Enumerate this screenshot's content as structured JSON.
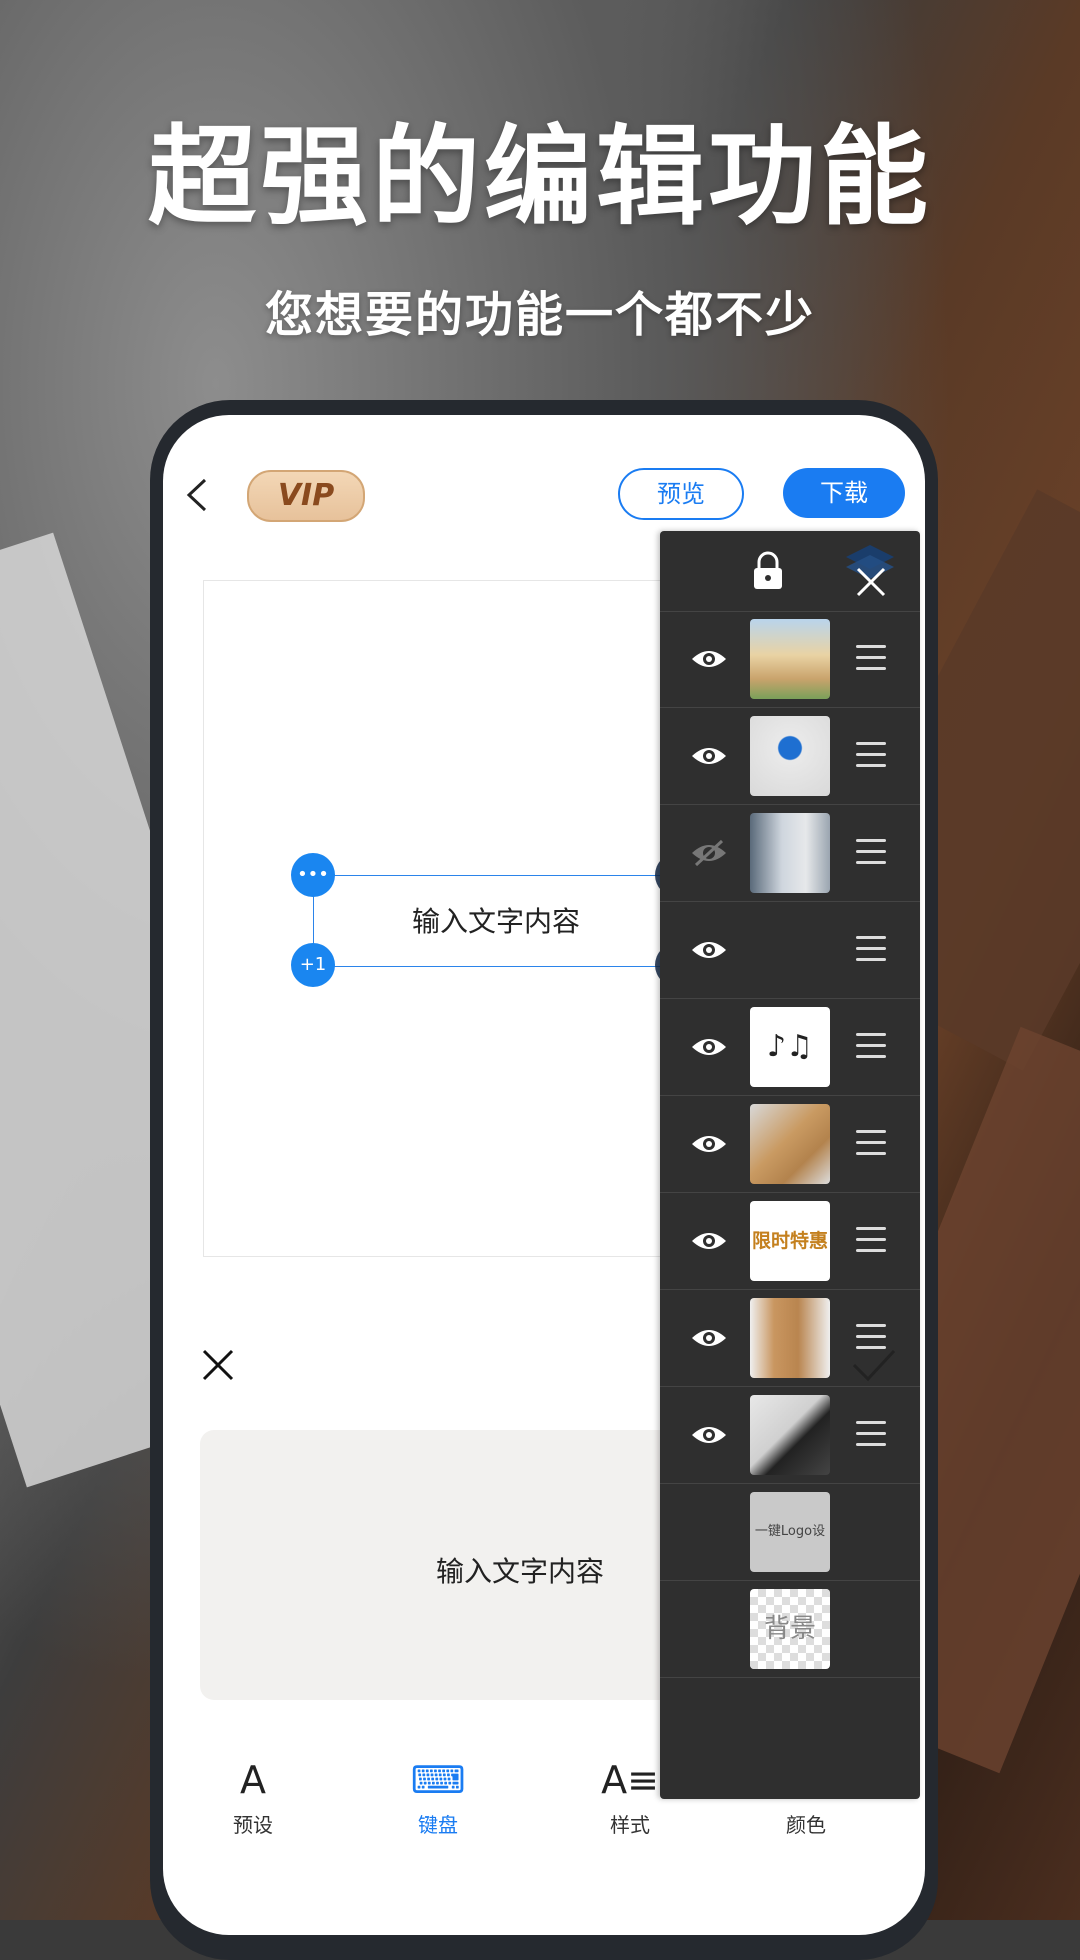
{
  "promo": {
    "headline": "超强的编辑功能",
    "subline": "您想要的功能一个都不少"
  },
  "topbar": {
    "vip_label": "VIP",
    "preview_label": "预览",
    "download_label": "下载"
  },
  "canvas": {
    "text_box_content": "输入文字内容",
    "handle_menu_icon": "more-dots-icon",
    "handle_add_label": "+1"
  },
  "editor": {
    "input_text": "输入文字内容"
  },
  "tabs": [
    {
      "label": "预设",
      "icon": "font-a-icon",
      "active": false
    },
    {
      "label": "键盘",
      "icon": "keyboard-icon",
      "active": true
    },
    {
      "label": "样式",
      "icon": "text-style-icon",
      "active": false
    },
    {
      "label": "颜色",
      "icon": "text-color-icon",
      "active": false
    }
  ],
  "layers": {
    "items": [
      {
        "name": "photo-church",
        "visible": true
      },
      {
        "name": "logo-kepler",
        "visible": true
      },
      {
        "name": "photo-street",
        "visible": false
      },
      {
        "name": "text-layer",
        "visible": true
      },
      {
        "name": "music-sticker",
        "visible": true,
        "locked": true
      },
      {
        "name": "mockup-card",
        "visible": true
      },
      {
        "name": "promo-text-限时特惠",
        "visible": true,
        "thumb_text": "限时特惠"
      },
      {
        "name": "bag-mockup",
        "visible": true
      },
      {
        "name": "tshirt-mockup",
        "visible": true
      },
      {
        "name": "logo-label",
        "visible": null,
        "thumb_text": "一键Logo设计"
      },
      {
        "name": "background",
        "visible": null,
        "thumb_text": "背景"
      }
    ]
  },
  "colors": {
    "accent": "#1a7cf2",
    "panel_bg": "#2f2f2f",
    "vip_text": "#8a4a1e"
  }
}
